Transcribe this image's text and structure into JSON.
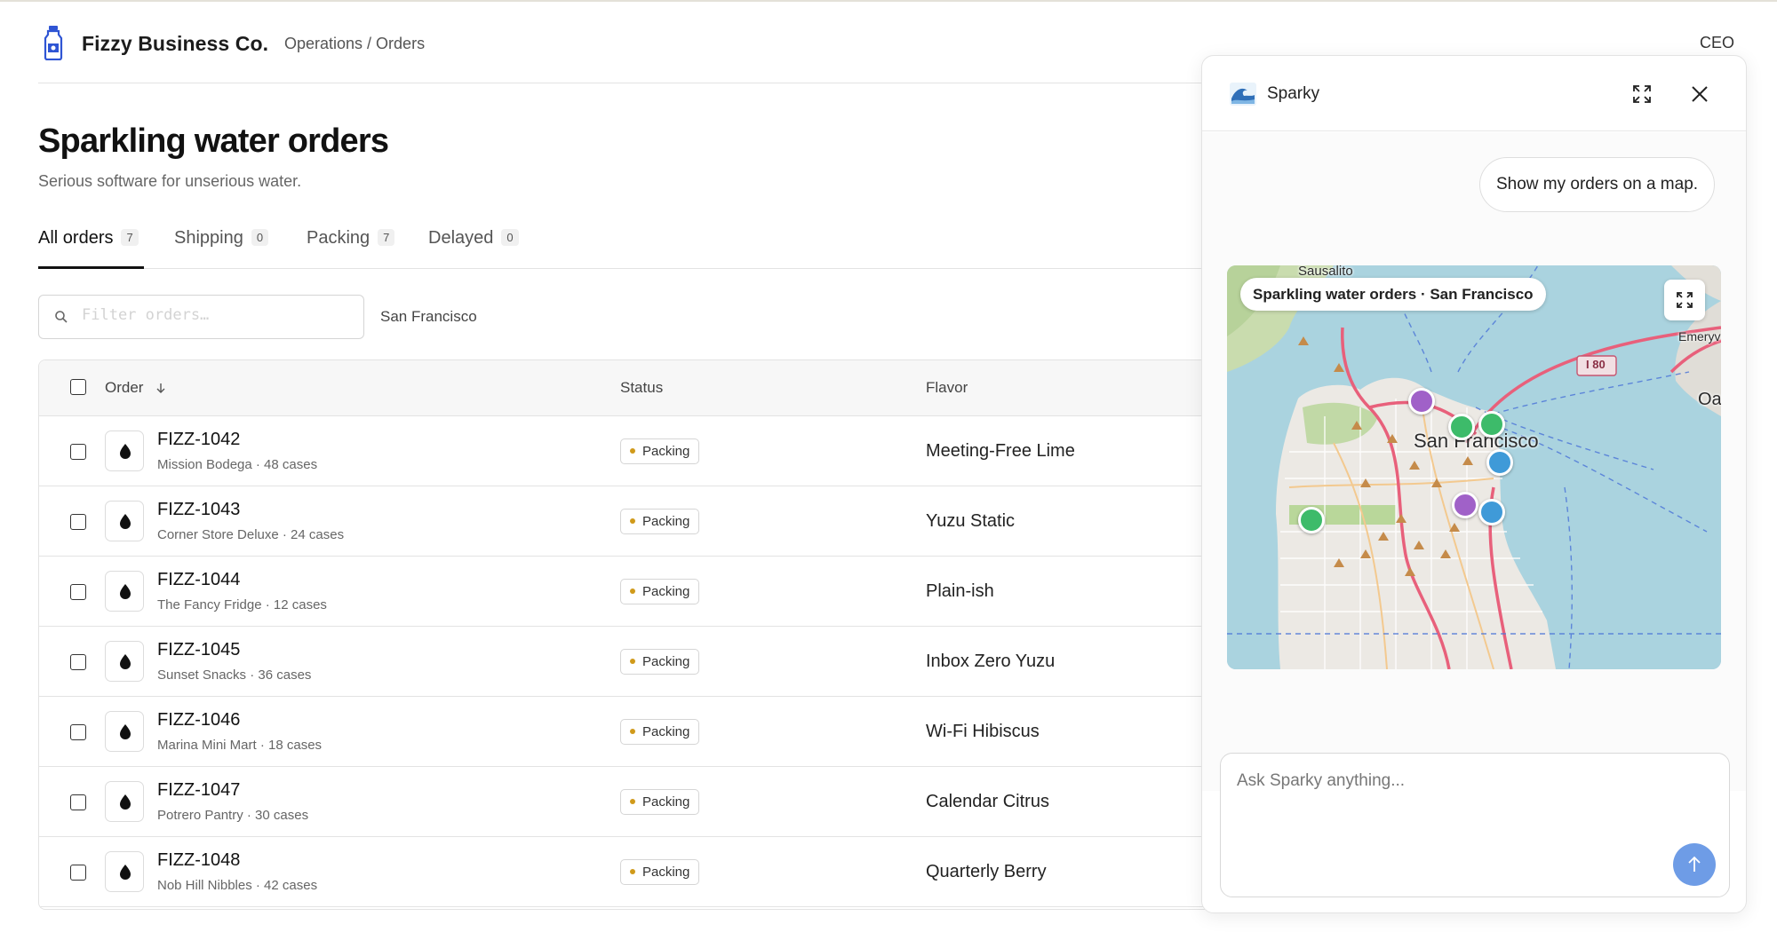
{
  "header": {
    "brand": "Fizzy Business Co.",
    "breadcrumb": "Operations / Orders",
    "role": "CEO"
  },
  "page": {
    "title": "Sparkling water orders",
    "subtitle": "Serious software for unserious water."
  },
  "tabs": [
    {
      "label": "All orders",
      "count": "7",
      "active": true
    },
    {
      "label": "Shipping",
      "count": "0",
      "active": false
    },
    {
      "label": "Packing",
      "count": "7",
      "active": false
    },
    {
      "label": "Delayed",
      "count": "0",
      "active": false
    }
  ],
  "filter": {
    "placeholder": "Filter orders…",
    "location": "San Francisco"
  },
  "table": {
    "columns": {
      "order": "Order",
      "status": "Status",
      "flavor": "Flavor"
    },
    "sort_icon": "arrow-down-icon",
    "rows": [
      {
        "id": "FIZZ-1042",
        "meta": "Mission Bodega · 48 cases",
        "status": "Packing",
        "flavor": "Meeting-Free Lime"
      },
      {
        "id": "FIZZ-1043",
        "meta": "Corner Store Deluxe · 24 cases",
        "status": "Packing",
        "flavor": "Yuzu Static"
      },
      {
        "id": "FIZZ-1044",
        "meta": "The Fancy Fridge · 12 cases",
        "status": "Packing",
        "flavor": "Plain-ish"
      },
      {
        "id": "FIZZ-1045",
        "meta": "Sunset Snacks · 36 cases",
        "status": "Packing",
        "flavor": "Inbox Zero Yuzu"
      },
      {
        "id": "FIZZ-1046",
        "meta": "Marina Mini Mart · 18 cases",
        "status": "Packing",
        "flavor": "Wi-Fi Hibiscus"
      },
      {
        "id": "FIZZ-1047",
        "meta": "Potrero Pantry · 30 cases",
        "status": "Packing",
        "flavor": "Calendar Citrus"
      },
      {
        "id": "FIZZ-1048",
        "meta": "Nob Hill Nibbles · 42 cases",
        "status": "Packing",
        "flavor": "Quarterly Berry"
      }
    ]
  },
  "chat": {
    "title": "Sparky",
    "user_message": "Show my orders on a map.",
    "map": {
      "title": "Sparkling water orders · San Francisco",
      "labels": {
        "city": "San Francisco",
        "sausalito": "Sausalito",
        "emeryville": "Emeryv",
        "oakland": "Oa",
        "highway": "I 80"
      },
      "pin_colors": {
        "purple": "#a061c8",
        "green": "#3dbb6a",
        "blue": "#3f9ad8"
      }
    },
    "input_placeholder": "Ask Sparky anything..."
  },
  "colors": {
    "accent": "#6e9ce6",
    "status_dot": "#d09a1a"
  }
}
